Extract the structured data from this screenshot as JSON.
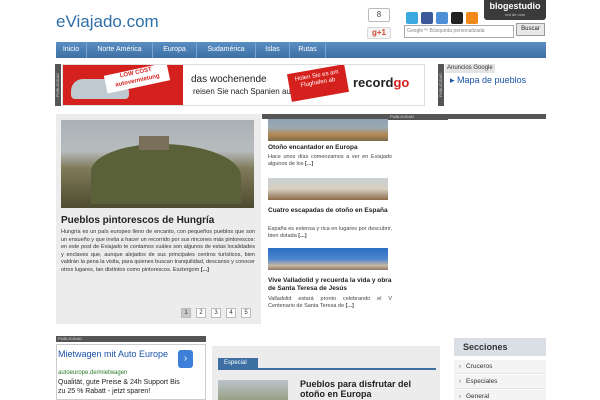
{
  "header": {
    "site_title": "eViajado.com",
    "like_count": "8",
    "gplus_label": "g+1",
    "search_placeholder": "Google™ Búsqueda personalizada",
    "search_button": "Buscar",
    "brand_name": "blogestudio",
    "brand_tagline": "red de ocio"
  },
  "nav": {
    "items": [
      "Inicio",
      "Norte América",
      "Europa",
      "Sudamérica",
      "Islas",
      "Rutas"
    ]
  },
  "banner_ad": {
    "side_label": "PUBLICIDAD",
    "lowcost_text": "LOW COST autovermietung",
    "headline": "das wochenende",
    "subline": "reisen Sie nach Spanien aus!",
    "stamp_text": "Holen Sie es am Flughafen ab",
    "brand": "record",
    "brand_suffix": "go",
    "brand_sub": "rent a car"
  },
  "google_ads": {
    "label": "Anuncios Google",
    "link": "Mapa de pueblos"
  },
  "featured": {
    "title": "Pueblos pintorescos de Hungría",
    "description": "Hungría es un país europeo lleno de encanto, con pequeños pueblos que son un ensueño y que invita a hacer un recorrido por sus rincones más pintorescos: en este post de Eviajado te contamos cuáles son algunos de estas localidades y enclaves que, aunque alejados de sus principales centros turísticos, bien valdrán la pena la visita, para quienes buscan tranquilidad, descanso y conocer otros lugares, tan distintos como pintorescos. Esztergom",
    "more": "[...]",
    "pages": [
      "1",
      "2",
      "3",
      "4",
      "5"
    ],
    "active_page": "1"
  },
  "articles": [
    {
      "title": "Otoño encantador en Europa",
      "description": "Hace unos días comenzamos a ver en Eviajado algunos de los",
      "more": "[...]"
    },
    {
      "title": "Cuatro escapadas de otoño en España",
      "description": "España es extensa y rica en lugares por descubrir, bien dotada",
      "more": "[...]"
    },
    {
      "title": "Vive Valladolid y recuerda la vida y obra de Santa Teresa de Jesús",
      "description": "Valladolid estará pronto celebrando el V Centenario de Santa Teresa de",
      "more": "[...]"
    }
  ],
  "middle_publicidad": "PUBLICIDAD",
  "bottom_ad": {
    "label": "PUBLICIDAD",
    "title": "Mietwagen mit Auto Europe",
    "url": "autoeurope.de/mietwagen",
    "text": "Qualität, gute Preise & 24h Support Bis zu 25 % Rabatt - jetzt sparen!"
  },
  "special": {
    "tab": "Especial",
    "title": "Pueblos para disfrutar del otoño en Europa"
  },
  "secciones": {
    "title": "Secciones",
    "items": [
      "Cruceros",
      "Especiales",
      "General"
    ]
  }
}
